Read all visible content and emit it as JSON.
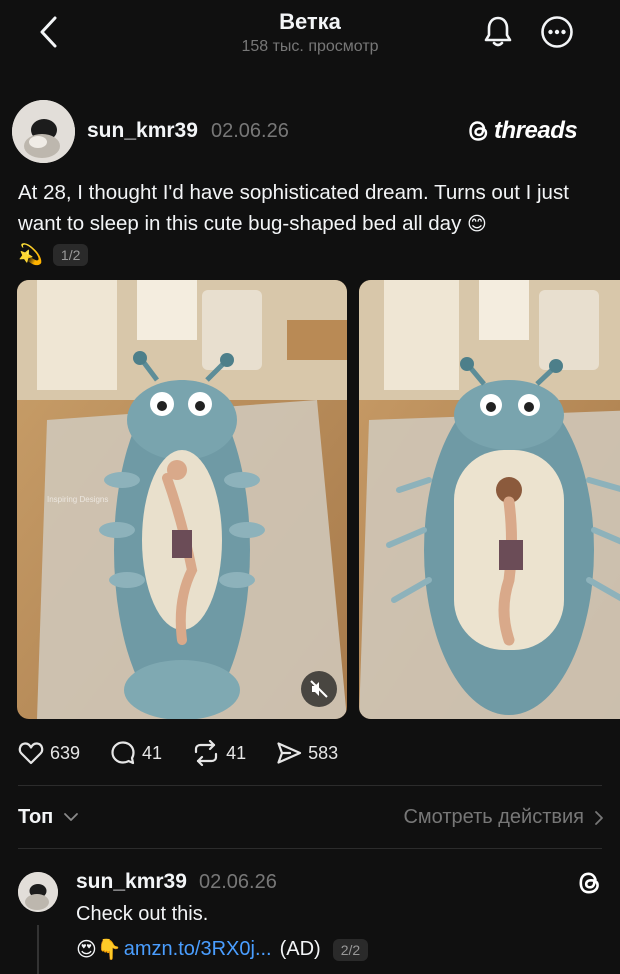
{
  "header": {
    "title": "Ветка",
    "views": "158 тыс. просмотр"
  },
  "post": {
    "username": "sun_kmr39",
    "date": "02.06.26",
    "brand": "threads",
    "text": "At 28, I thought I'd have sophisticated dream. Turns out I just want to sleep in this cute bug-shaped bed all day",
    "text_emoji": "😊",
    "sparkle_emoji": "💫",
    "page_indicator": "1/2",
    "watermark": "Inspiring Designs",
    "likes": "639",
    "comments": "41",
    "reposts": "41",
    "shares": "583"
  },
  "sort": {
    "label": "Топ",
    "view_actions": "Смотреть действия"
  },
  "reply": {
    "username": "sun_kmr39",
    "date": "02.06.26",
    "text": "Check out this.",
    "emojis": "😍👇",
    "link": "amzn.to/3RX0j...",
    "ad": "(AD)",
    "page_indicator": "2/2"
  },
  "colors": {
    "background": "#101010",
    "text_primary": "#f3f5f7",
    "text_secondary": "#777777",
    "link": "#4a9eff"
  }
}
